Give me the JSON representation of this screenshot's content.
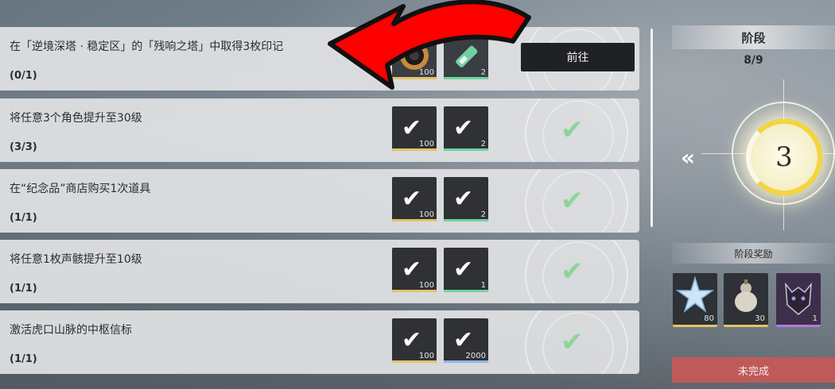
{
  "tasks": [
    {
      "title": "在「逆境深塔 · 稳定区」的「残响之塔」中取得3枚印记",
      "progress": "(0/1)",
      "reward1_count": "100",
      "reward2_count": "2",
      "action_label": "前往",
      "completed": false
    },
    {
      "title": "将任意3个角色提升至30级",
      "progress": "(3/3)",
      "reward1_count": "100",
      "reward2_count": "2",
      "completed": true
    },
    {
      "title": "在“纪念品”商店购买1次道具",
      "progress": "(1/1)",
      "reward1_count": "100",
      "reward2_count": "2",
      "completed": true
    },
    {
      "title": "将任意1枚声骸提升至10级",
      "progress": "(1/1)",
      "reward1_count": "100",
      "reward2_count": "1",
      "completed": true
    },
    {
      "title": "激活虎口山脉的中枢信标",
      "progress": "(1/1)",
      "reward1_count": "100",
      "reward2_count": "2000",
      "completed": true
    }
  ],
  "stage_panel": {
    "title": "阶段",
    "count": "8/9",
    "current_stage": "3",
    "rewards_label": "阶段奖励",
    "rewards": [
      {
        "icon": "star-crystal-icon",
        "count": "80"
      },
      {
        "icon": "gourd-icon",
        "count": "30"
      },
      {
        "icon": "creature-portrait-icon",
        "count": "1"
      }
    ],
    "status_button": "未完成"
  },
  "colors": {
    "accent_gold": "#e3c467",
    "accent_green": "#6ed4a0",
    "stage_ring": "#f5d53c",
    "incomplete_red": "#c05a5a",
    "annotation_arrow": "#ff0000"
  }
}
